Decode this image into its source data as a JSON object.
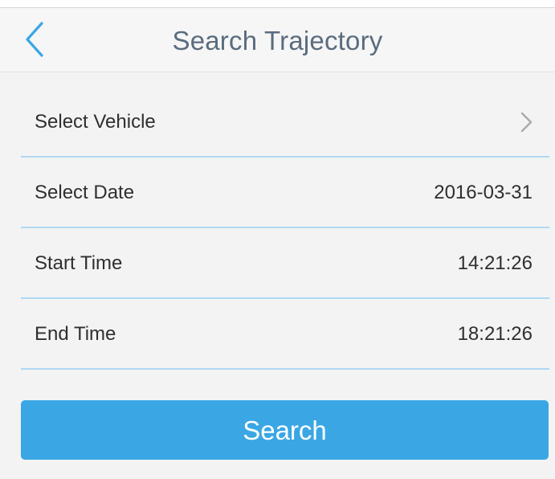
{
  "header": {
    "title": "Search Trajectory",
    "back_icon": "chevron-left-icon"
  },
  "form": {
    "rows": [
      {
        "label": "Select Vehicle",
        "value": "",
        "icon": "chevron-right-icon"
      },
      {
        "label": "Select Date",
        "value": "2016-03-31"
      },
      {
        "label": "Start Time",
        "value": "14:21:26"
      },
      {
        "label": "End Time",
        "value": "18:21:26"
      }
    ]
  },
  "actions": {
    "search_label": "Search"
  },
  "colors": {
    "accent": "#3aa7e4",
    "divider": "#aed8f3",
    "nav_icon": "#3aa7e4",
    "title_text": "#5a6c7e",
    "background": "#f3f3f3"
  }
}
